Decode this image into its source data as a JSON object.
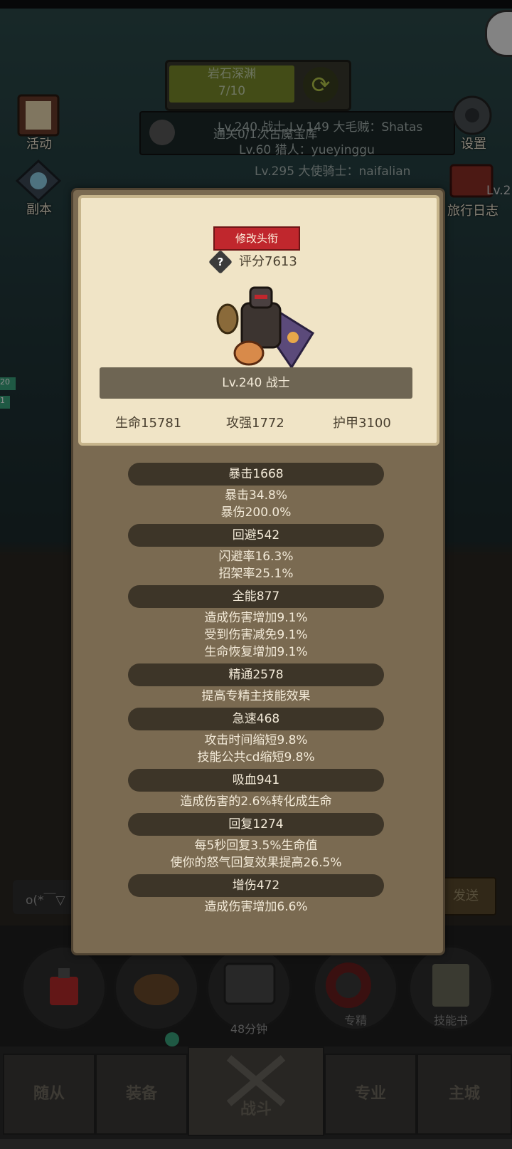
{
  "background": {
    "stage_name": "岩石深渊",
    "stage_progress": "7/10",
    "banner_text": "通关0/1次古魔宝库",
    "chat_lines": [
      "Lv.240 战士  Lv.149 大毛贼：Shatas",
      "Lv.60 猎人：yueyinggu",
      "Lv.295 大使骑士：naifalian"
    ],
    "left_menu": [
      {
        "label": "活动",
        "icon": "scroll-icon"
      },
      {
        "label": "副本",
        "icon": "portal-icon"
      }
    ],
    "right_menu": [
      {
        "label": "设置",
        "icon": "gear-icon"
      },
      {
        "label": "旅行日志",
        "icon": "book-icon"
      }
    ],
    "right_level_hint": "Lv.2",
    "left_badges": [
      "20",
      "1"
    ],
    "chat_input_placeholder": "o(*￣▽",
    "send_label": "发送",
    "bottom_buttons": [
      {
        "label": "",
        "icon": "potion-icon"
      },
      {
        "label": "",
        "icon": "bread-icon"
      },
      {
        "label": "48分钟",
        "icon": "chest-icon"
      },
      {
        "label": "专精",
        "icon": "target-icon"
      },
      {
        "label": "技能书",
        "icon": "skillbook-icon"
      }
    ],
    "nav_tabs": [
      "随从",
      "装备",
      "战斗",
      "专业",
      "主城"
    ],
    "active_tab": "战斗"
  },
  "panel": {
    "edit_title_label": "修改头衔",
    "score": "评分7613",
    "level_class": "Lv.240 战士",
    "hp": "生命15781",
    "attack": "攻强1772",
    "armor": "护甲3100",
    "sections": [
      {
        "header": "暴击1668",
        "lines": [
          "暴击34.8%",
          "暴伤200.0%"
        ]
      },
      {
        "header": "回避542",
        "lines": [
          "闪避率16.3%",
          "招架率25.1%"
        ]
      },
      {
        "header": "全能877",
        "lines": [
          "造成伤害增加9.1%",
          "受到伤害减免9.1%",
          "生命恢复增加9.1%"
        ]
      },
      {
        "header": "精通2578",
        "lines": [
          "提高专精主技能效果"
        ]
      },
      {
        "header": "急速468",
        "lines": [
          "攻击时间缩短9.8%",
          "技能公共cd缩短9.8%"
        ]
      },
      {
        "header": "吸血941",
        "lines": [
          "造成伤害的2.6%转化成生命"
        ]
      },
      {
        "header": "回复1274",
        "lines": [
          "每5秒回复3.5%生命值",
          "使你的怒气回复效果提高26.5%"
        ]
      },
      {
        "header": "增伤472",
        "lines": [
          "造成伤害增加6.6%"
        ]
      }
    ]
  },
  "colors": {
    "title_button": "#c0272d",
    "panel_bg": "#7a6a51",
    "card_bg": "#f0e4c6"
  }
}
